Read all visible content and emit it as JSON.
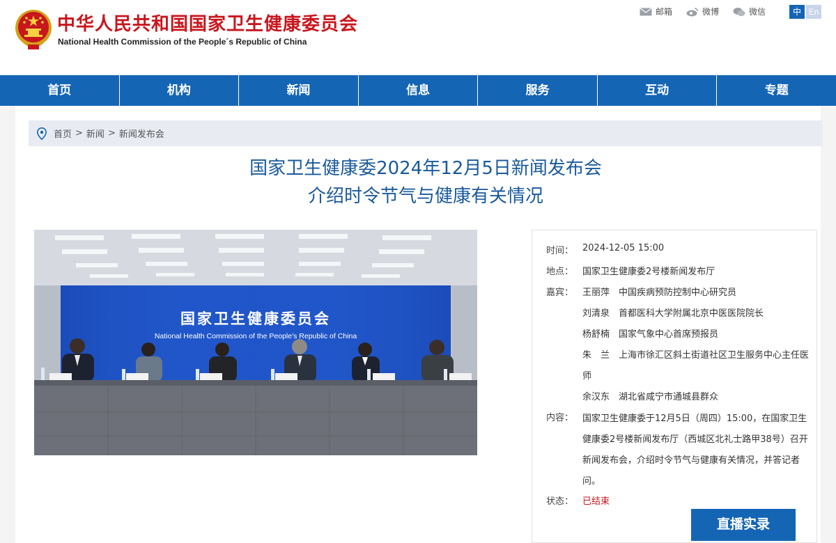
{
  "header": {
    "title_cn": "中华人民共和国国家卫生健康委员会",
    "title_en": "National Health Commission of the People´s Republic of China",
    "links": [
      {
        "label": "邮箱",
        "icon": "mail-icon"
      },
      {
        "label": "微博",
        "icon": "weibo-icon"
      },
      {
        "label": "微信",
        "icon": "wechat-icon"
      }
    ],
    "lang_cn": "中",
    "lang_en": "En"
  },
  "nav": {
    "items": [
      "首页",
      "机构",
      "新闻",
      "信息",
      "服务",
      "互动",
      "专题"
    ]
  },
  "breadcrumb": {
    "items": [
      "首页",
      "新闻",
      "新闻发布会"
    ],
    "sep": ">"
  },
  "article": {
    "title_line1": "国家卫生健康委2024年12月5日新闻发布会",
    "title_line2": "介绍时令节气与健康有关情况"
  },
  "photo": {
    "backdrop_cn": "国家卫生健康委员会",
    "backdrop_en": "National Health Commission of the People's Republic of China"
  },
  "info": {
    "time_label": "时间：",
    "time_value": "2024-12-05 15:00",
    "place_label": "地点：",
    "place_value": "国家卫生健康委2号楼新闻发布厅",
    "guests_label": "嘉宾：",
    "guests": [
      {
        "name": "王丽萍",
        "title": "中国疾病预防控制中心研究员"
      },
      {
        "name": "刘清泉",
        "title": "首都医科大学附属北京中医医院院长"
      },
      {
        "name": "杨舒楠",
        "title": "国家气象中心首席预报员"
      },
      {
        "name": "朱　兰",
        "title": "上海市徐汇区斜土街道社区卫生服务中心主任医"
      },
      {
        "name": "",
        "title": "师"
      },
      {
        "name": "余汉东",
        "title": "湖北省咸宁市通城县群众"
      }
    ],
    "content_label": "内容：",
    "content_value": "国家卫生健康委于12月5日（周四）15:00，在国家卫生健康委2号楼新闻发布厅（西城区北礼士路甲38号）召开新闻发布会，介绍时令节气与健康有关情况，并答记者问。",
    "status_label": "状态：",
    "status_value": "已结束",
    "status_color": "#c8161d",
    "live_button": "直播实录"
  },
  "colors": {
    "brand_blue": "#1565b5",
    "brand_red": "#c8161d",
    "title_blue": "#1a5a9c"
  }
}
